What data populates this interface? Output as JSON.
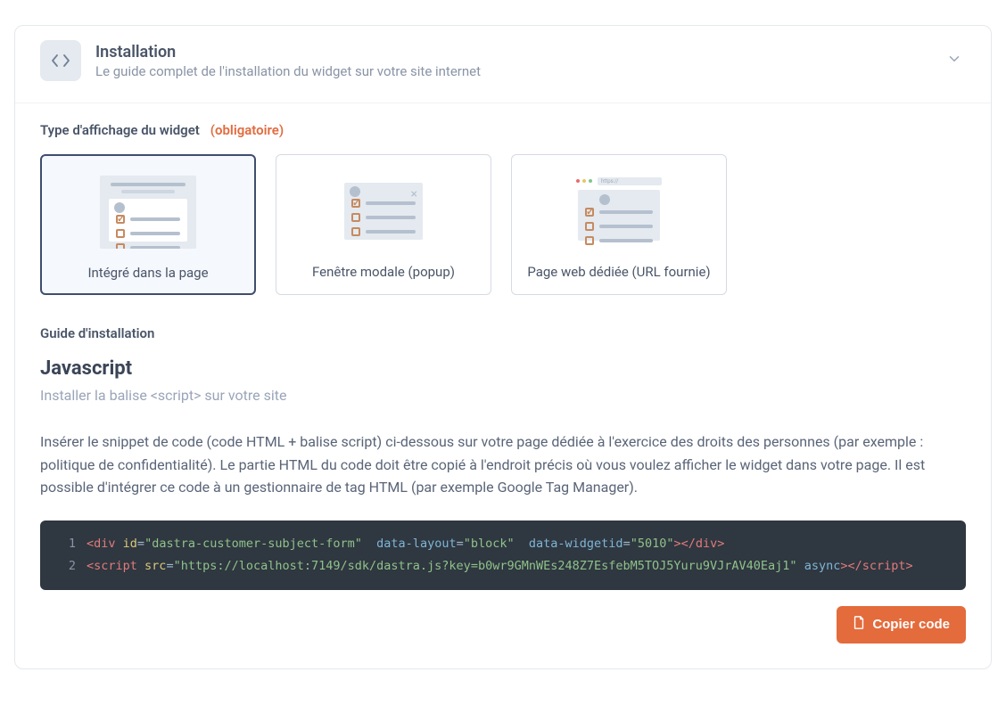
{
  "header": {
    "title": "Installation",
    "subtitle": "Le guide complet de l'installation du widget sur votre site internet"
  },
  "displayType": {
    "label": "Type d'affichage du widget",
    "required": "(obligatoire)",
    "options": [
      {
        "label": "Intégré dans la page",
        "selected": true
      },
      {
        "label": "Fenêtre modale (popup)",
        "selected": false
      },
      {
        "label": "Page web dédiée (URL fournie)",
        "selected": false
      }
    ]
  },
  "guide": {
    "label": "Guide d'installation",
    "jsTitle": "Javascript",
    "jsSub": "Installer la balise <script> sur votre site",
    "paragraph": "Insérer le snippet de code (code HTML + balise script) ci-dessous sur votre page dédiée à l'exercice des droits des personnes (par exemple : politique de confidentialité). Le partie HTML du code doit être copié à l'endroit précis où vous voulez afficher le widget dans votre page. Il est possible d'intégrer ce code à un gestionnaire de tag HTML (par exemple Google Tag Manager)."
  },
  "code": {
    "line1": {
      "num": "1",
      "open": "<div",
      "attr1": "id",
      "val1": "\"dastra-customer-subject-form\"",
      "attr2": "data-layout",
      "val2": "\"block\"",
      "attr3": "data-widgetid",
      "val3": "\"5010\"",
      "close": "></div>"
    },
    "line2": {
      "num": "2",
      "open": "<script",
      "attr1": "src",
      "val1": "\"https://localhost:7149/sdk/dastra.js?key=b0wr9GMnWEs248Z7EsfebM5TOJ5Yuru9VJrAV40Eaj1\"",
      "attr2": "async",
      "close1": ">",
      "close2": "</script>"
    }
  },
  "copyButton": "Copier code"
}
